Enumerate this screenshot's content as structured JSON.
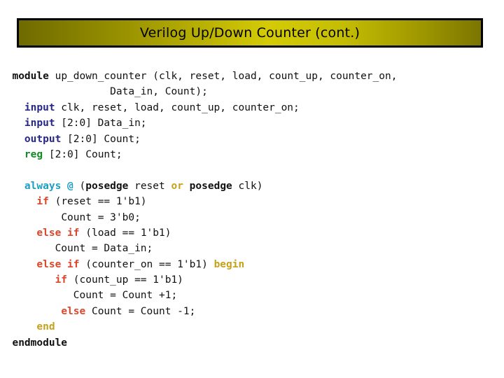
{
  "slide": {
    "title": "Verilog Up/Down Counter (cont.)",
    "background_color": "#ffffff",
    "banner_border_color": "#000000",
    "banner_gradient_dark": "#6f6a00",
    "banner_gradient_bright": "#d4cb05",
    "title_color": "#000000"
  },
  "syntax_colors": {
    "plain": "#111111",
    "declaration_keyword": "#26268c",
    "reg_keyword": "#128c28",
    "block_keyword": "#c6a21a",
    "control_keyword": "#d9482b",
    "edge_keyword": "#1f9ec4",
    "bold_black": "#111111"
  },
  "code": {
    "language": "verilog",
    "lines": [
      {
        "indent": 2,
        "tokens": [
          {
            "text": "module",
            "style": "kw-bold"
          },
          {
            "text": " up_down_counter (clk, reset, load, count_up, counter_on,",
            "style": "plain"
          }
        ]
      },
      {
        "indent": 18,
        "tokens": [
          {
            "text": "Data_in, Count);",
            "style": "plain"
          }
        ]
      },
      {
        "indent": 4,
        "tokens": [
          {
            "text": "input",
            "style": "kw-decl"
          },
          {
            "text": " clk, reset, load, count_up, counter_on;",
            "style": "plain"
          }
        ]
      },
      {
        "indent": 4,
        "tokens": [
          {
            "text": "input",
            "style": "kw-decl"
          },
          {
            "text": " [2:0] Data_in;",
            "style": "plain"
          }
        ]
      },
      {
        "indent": 4,
        "tokens": [
          {
            "text": "output",
            "style": "kw-decl"
          },
          {
            "text": " [2:0] Count;",
            "style": "plain"
          }
        ]
      },
      {
        "indent": 4,
        "tokens": [
          {
            "text": "reg",
            "style": "kw-reg"
          },
          {
            "text": " [2:0] Count;",
            "style": "plain"
          }
        ]
      },
      {
        "indent": 0,
        "blank": true,
        "tokens": []
      },
      {
        "indent": 4,
        "tokens": [
          {
            "text": "always",
            "style": "kw-edge"
          },
          {
            "text": " ",
            "style": "plain"
          },
          {
            "text": "@",
            "style": "kw-edge"
          },
          {
            "text": " (",
            "style": "plain"
          },
          {
            "text": "posedge",
            "style": "kw-bold"
          },
          {
            "text": " reset ",
            "style": "plain"
          },
          {
            "text": "or",
            "style": "kw-blk"
          },
          {
            "text": " ",
            "style": "plain"
          },
          {
            "text": "posedge",
            "style": "kw-bold"
          },
          {
            "text": " clk)",
            "style": "plain"
          }
        ]
      },
      {
        "indent": 6,
        "tokens": [
          {
            "text": "if",
            "style": "kw-ctrl"
          },
          {
            "text": " (reset == 1'b1)",
            "style": "plain"
          }
        ]
      },
      {
        "indent": 10,
        "tokens": [
          {
            "text": "Count = 3'b0;",
            "style": "plain"
          }
        ]
      },
      {
        "indent": 6,
        "tokens": [
          {
            "text": "else",
            "style": "kw-ctrl"
          },
          {
            "text": " ",
            "style": "plain"
          },
          {
            "text": "if",
            "style": "kw-ctrl"
          },
          {
            "text": " (load == 1'b1)",
            "style": "plain"
          }
        ]
      },
      {
        "indent": 9,
        "tokens": [
          {
            "text": "Count = Data_in;",
            "style": "plain"
          }
        ]
      },
      {
        "indent": 6,
        "tokens": [
          {
            "text": "else",
            "style": "kw-ctrl"
          },
          {
            "text": " ",
            "style": "plain"
          },
          {
            "text": "if",
            "style": "kw-ctrl"
          },
          {
            "text": " (counter_on == 1'b1) ",
            "style": "plain"
          },
          {
            "text": "begin",
            "style": "kw-blk"
          }
        ]
      },
      {
        "indent": 9,
        "tokens": [
          {
            "text": "if",
            "style": "kw-ctrl"
          },
          {
            "text": " (count_up == 1'b1)",
            "style": "plain"
          }
        ]
      },
      {
        "indent": 12,
        "tokens": [
          {
            "text": "Count = Count +1;",
            "style": "plain"
          }
        ]
      },
      {
        "indent": 10,
        "tokens": [
          {
            "text": "else",
            "style": "kw-ctrl"
          },
          {
            "text": " Count = Count -1;",
            "style": "plain"
          }
        ]
      },
      {
        "indent": 6,
        "tokens": [
          {
            "text": "end",
            "style": "kw-blk"
          }
        ]
      },
      {
        "indent": 2,
        "tokens": [
          {
            "text": "endmodule",
            "style": "kw-bold"
          }
        ]
      }
    ]
  }
}
